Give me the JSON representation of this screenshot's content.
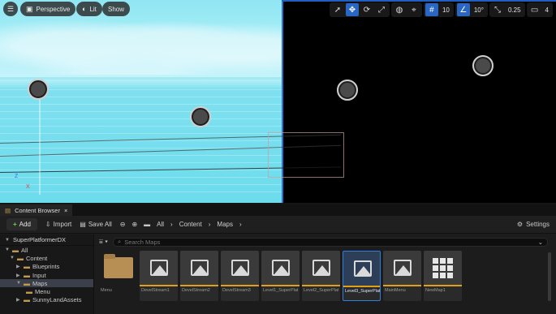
{
  "viewport": {
    "menu_icon": "hamburger-icon",
    "perspective_label": "Perspective",
    "lit_label": "Lit",
    "show_label": "Show",
    "grid_snap_value": "10",
    "rotation_snap_value": "10°",
    "scale_snap_value": "0.25",
    "camera_speed_value": "4",
    "axis_z": "Z",
    "axis_x": "X",
    "colors": {
      "sky": "#8fe6f2",
      "sea": "#6cdcec",
      "accent": "#2a66c4"
    }
  },
  "content_browser": {
    "tab_title": "Content Browser",
    "tab_close": "×",
    "add_label": "Add",
    "import_label": "Import",
    "save_all_label": "Save All",
    "breadcrumb": [
      "All",
      "Content",
      "Maps"
    ],
    "settings_label": "Settings",
    "search_placeholder": "Search Maps",
    "tree": {
      "root": "SuperPlatformerDX",
      "items": [
        {
          "label": "All",
          "depth": 0
        },
        {
          "label": "Content",
          "depth": 1
        },
        {
          "label": "Blueprints",
          "depth": 2
        },
        {
          "label": "Input",
          "depth": 2
        },
        {
          "label": "Maps",
          "depth": 2
        },
        {
          "label": "Menu",
          "depth": 3
        },
        {
          "label": "SunnyLandAssets",
          "depth": 2
        }
      ]
    },
    "assets": [
      {
        "label": "Menu",
        "kind": "folder"
      },
      {
        "label": "DevelStream1",
        "kind": "level"
      },
      {
        "label": "DevelStream2",
        "kind": "level"
      },
      {
        "label": "DevelStream3",
        "kind": "level"
      },
      {
        "label": "Level1_SuperPlatformerXD",
        "kind": "level"
      },
      {
        "label": "Level2_SuperPlatformerXD",
        "kind": "level"
      },
      {
        "label": "Level3_SuperPlatformerXD",
        "kind": "level",
        "selected": true
      },
      {
        "label": "MainMenu",
        "kind": "level"
      },
      {
        "label": "NewMap1",
        "kind": "grid"
      }
    ]
  }
}
